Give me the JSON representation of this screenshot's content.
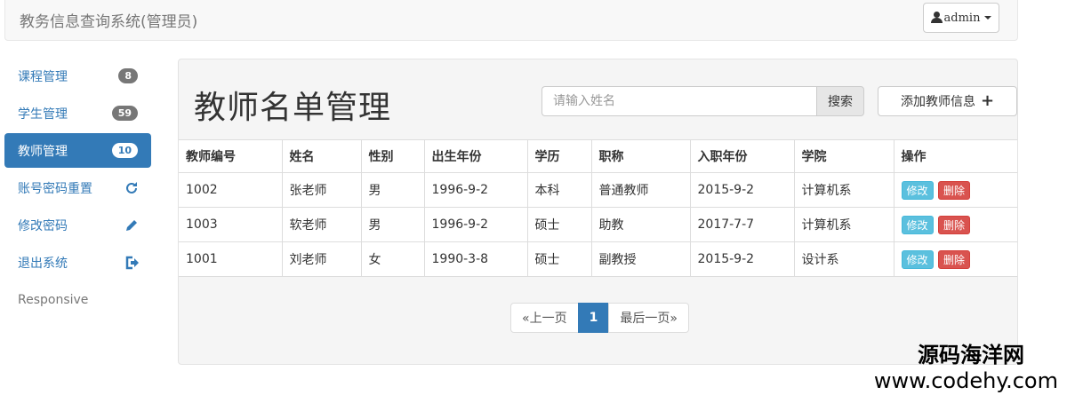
{
  "navbar": {
    "brand": "教务信息查询系统(管理员)",
    "user_label": "admin"
  },
  "sidebar": {
    "items": [
      {
        "label": "课程管理",
        "badge": "8"
      },
      {
        "label": "学生管理",
        "badge": "59"
      },
      {
        "label": "教师管理",
        "badge": "10"
      },
      {
        "label": "账号密码重置",
        "icon": "refresh-icon"
      },
      {
        "label": "修改密码",
        "icon": "pencil-icon"
      },
      {
        "label": "退出系统",
        "icon": "logout-icon"
      }
    ],
    "footer": "Responsive"
  },
  "main": {
    "title": "教师名单管理",
    "search": {
      "placeholder": "请输入姓名",
      "button": "搜索"
    },
    "add_button": "添加教师信息",
    "table": {
      "headers": [
        "教师编号",
        "姓名",
        "性别",
        "出生年份",
        "学历",
        "职称",
        "入职年份",
        "学院",
        "操作"
      ],
      "rows": [
        {
          "id": "1002",
          "name": "张老师",
          "gender": "男",
          "birth": "1996-9-2",
          "education": "本科",
          "title": "普通教师",
          "hired": "2015-9-2",
          "college": "计算机系"
        },
        {
          "id": "1003",
          "name": "软老师",
          "gender": "男",
          "birth": "1996-9-2",
          "education": "硕士",
          "title": "助教",
          "hired": "2017-7-7",
          "college": "计算机系"
        },
        {
          "id": "1001",
          "name": "刘老师",
          "gender": "女",
          "birth": "1990-3-8",
          "education": "硕士",
          "title": "副教授",
          "hired": "2015-9-2",
          "college": "设计系"
        }
      ],
      "edit_label": "修改",
      "delete_label": "删除"
    },
    "pagination": {
      "prev": "«上一页",
      "current": "1",
      "last": "最后一页»"
    }
  },
  "watermark": {
    "line1": "源码海洋网",
    "line2": "www.codehy.com"
  },
  "colors": {
    "primary": "#337ab7",
    "info": "#5bc0de",
    "danger": "#d9534f"
  }
}
